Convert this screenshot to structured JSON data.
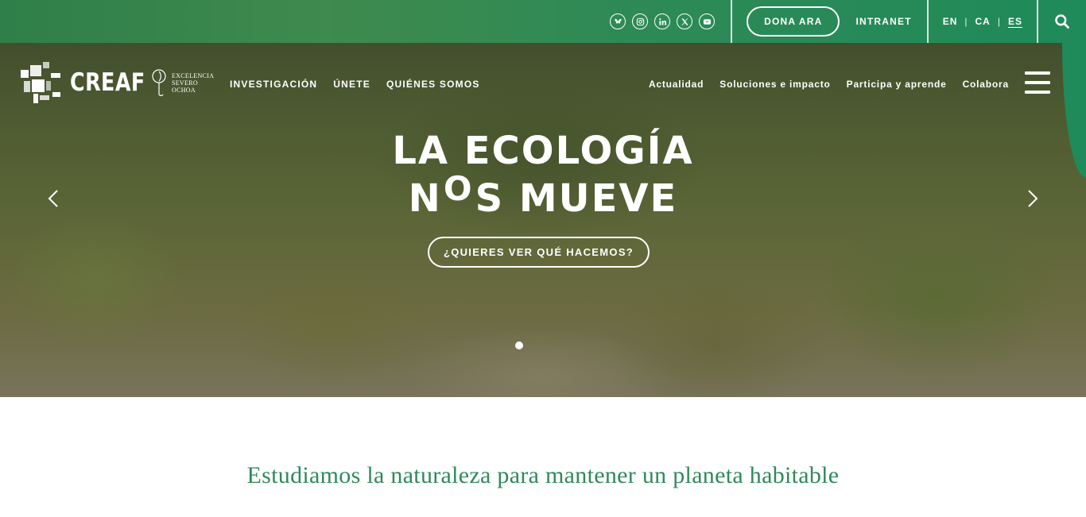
{
  "topbar": {
    "social": [
      {
        "icon": "bluesky-icon"
      },
      {
        "icon": "instagram-icon"
      },
      {
        "icon": "linkedin-icon"
      },
      {
        "icon": "x-icon"
      },
      {
        "icon": "youtube-icon"
      }
    ],
    "donate_label": "DONA ARA",
    "intranet_label": "INTRANET",
    "languages": [
      "EN",
      "CA",
      "ES"
    ],
    "active_language": "ES",
    "search_icon": "search-icon"
  },
  "brand": {
    "name": "CREAF",
    "severo_line1": "EXCELENCIA",
    "severo_line2": "SEVERO",
    "severo_line3": "OCHOA"
  },
  "nav": {
    "left": [
      "INVESTIGACIÓN",
      "ÚNETE",
      "QUIÉNES SOMOS"
    ],
    "right": [
      "Actualidad",
      "Soluciones e impacto",
      "Participa y aprende",
      "Colabora"
    ],
    "menu_icon": "hamburger-icon"
  },
  "hero": {
    "title_line1": "LA ECOLOGÍA",
    "title_line2_start": "N",
    "title_line2_o": "O",
    "title_line2_end": "S MUEVE",
    "cta_label": "¿QUIERES VER QUÉ HACEMOS?",
    "prev_icon": "chevron-left-icon",
    "next_icon": "chevron-right-icon"
  },
  "tagline": "Estudiamos la naturaleza para mantener un planeta habitable",
  "colors": {
    "brand_green": "#2f8a5a",
    "topbar_green": "#2f7f4a"
  }
}
